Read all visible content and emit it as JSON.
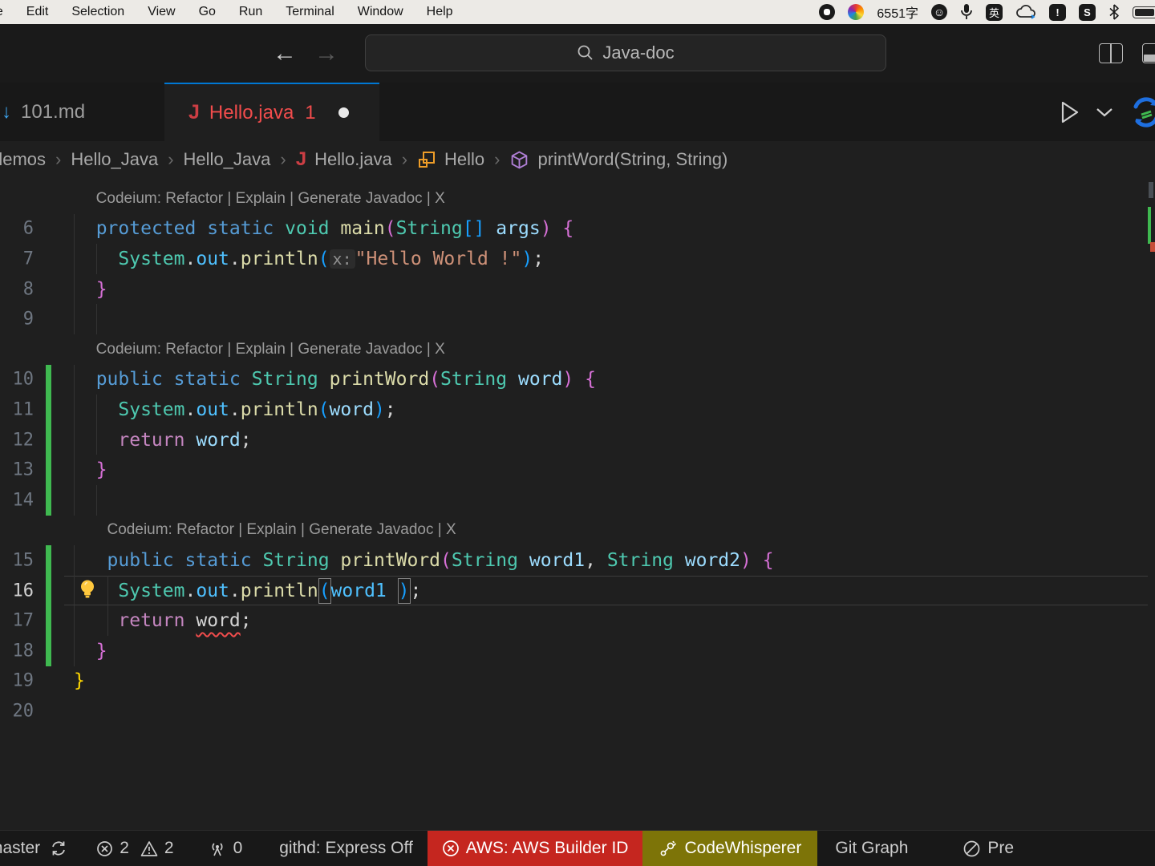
{
  "colors": {
    "accent_blue": "#0078D4",
    "tab_error_red": "#F14C4C",
    "java_icon_red": "#CC3E44",
    "added_green": "#3FB950",
    "error_red": "#F14C4C",
    "aws_red": "#C5261F",
    "codewhisperer_olive": "#7D7408",
    "bulb_yellow": "#FFC83D",
    "class_icon_orange": "#EE9D28",
    "method_icon_purple": "#B180D7"
  },
  "menu_bar": {
    "items": [
      "File",
      "Edit",
      "Selection",
      "View",
      "Go",
      "Run",
      "Terminal",
      "Window",
      "Help"
    ],
    "char_count": "6551字",
    "ime_badge": "英",
    "alert_badge": "!",
    "s_badge": "S"
  },
  "title_bar": {
    "search_value": "Java-doc"
  },
  "tab_bar": {
    "tabs": [
      {
        "name": "101.md",
        "icon": "markdown-icon",
        "icon_glyph": "↓"
      },
      {
        "name": "Hello.java",
        "badge": "1",
        "icon": "java-icon",
        "icon_glyph": "J",
        "modified": true
      }
    ]
  },
  "breadcrumb": [
    "demos",
    "Hello_Java",
    "Hello_Java",
    "Hello.java",
    "Hello",
    "printWord(String, String)"
  ],
  "editor": {
    "codelens": "Codeium: Refactor | Explain | Generate Javadoc | X",
    "rows": [
      {
        "kind": "lens",
        "indent": 2
      },
      {
        "kind": "code",
        "num": "6",
        "guides": [
          0
        ],
        "tokens": [
          [
            "  ",
            "pl"
          ],
          [
            "protected",
            "kw"
          ],
          [
            " ",
            "pl"
          ],
          [
            "static",
            "kw"
          ],
          [
            " ",
            "pl"
          ],
          [
            "void",
            "ty"
          ],
          [
            " ",
            "pl"
          ],
          [
            "main",
            "fn"
          ],
          [
            "(",
            "b2"
          ],
          [
            "String",
            "ty"
          ],
          [
            "[]",
            "b3"
          ],
          [
            " ",
            "pl"
          ],
          [
            "args",
            "vr"
          ],
          [
            ")",
            "b2"
          ],
          [
            " ",
            "pl"
          ],
          [
            "{",
            "b2"
          ]
        ]
      },
      {
        "kind": "code",
        "num": "7",
        "guides": [
          0,
          2
        ],
        "tokens": [
          [
            "    ",
            "pl"
          ],
          [
            "System",
            "ty"
          ],
          [
            ".",
            "pl"
          ],
          [
            "out",
            "pr"
          ],
          [
            ".",
            "pl"
          ],
          [
            "println",
            "fn"
          ],
          [
            "(",
            "b3"
          ],
          [
            "x:",
            "il"
          ],
          [
            "\"Hello World !\"",
            "st"
          ],
          [
            ")",
            "b3"
          ],
          [
            ";",
            "pl"
          ]
        ]
      },
      {
        "kind": "code",
        "num": "8",
        "guides": [
          0
        ],
        "tokens": [
          [
            "  ",
            "pl"
          ],
          [
            "}",
            "b2"
          ]
        ]
      },
      {
        "kind": "code",
        "num": "9",
        "guides": [
          0,
          2
        ],
        "tokens": []
      },
      {
        "kind": "lens",
        "indent": 2
      },
      {
        "kind": "code",
        "num": "10",
        "bar": true,
        "guides": [
          0
        ],
        "tokens": [
          [
            "  ",
            "pl"
          ],
          [
            "public",
            "kw"
          ],
          [
            " ",
            "pl"
          ],
          [
            "static",
            "kw"
          ],
          [
            " ",
            "pl"
          ],
          [
            "String",
            "ty"
          ],
          [
            " ",
            "pl"
          ],
          [
            "printWord",
            "fn"
          ],
          [
            "(",
            "b2"
          ],
          [
            "String",
            "ty"
          ],
          [
            " ",
            "pl"
          ],
          [
            "word",
            "vr"
          ],
          [
            ")",
            "b2"
          ],
          [
            " ",
            "pl"
          ],
          [
            "{",
            "b2"
          ]
        ]
      },
      {
        "kind": "code",
        "num": "11",
        "bar": true,
        "guides": [
          0,
          2
        ],
        "tokens": [
          [
            "    ",
            "pl"
          ],
          [
            "System",
            "ty"
          ],
          [
            ".",
            "pl"
          ],
          [
            "out",
            "pr"
          ],
          [
            ".",
            "pl"
          ],
          [
            "println",
            "fn"
          ],
          [
            "(",
            "b3"
          ],
          [
            "word",
            "vr"
          ],
          [
            ")",
            "b3"
          ],
          [
            ";",
            "pl"
          ]
        ]
      },
      {
        "kind": "code",
        "num": "12",
        "bar": true,
        "guides": [
          0,
          2
        ],
        "tokens": [
          [
            "    ",
            "pl"
          ],
          [
            "return",
            "ct"
          ],
          [
            " ",
            "pl"
          ],
          [
            "word",
            "vr"
          ],
          [
            ";",
            "pl"
          ]
        ]
      },
      {
        "kind": "code",
        "num": "13",
        "bar": true,
        "guides": [
          0
        ],
        "tokens": [
          [
            "  ",
            "pl"
          ],
          [
            "}",
            "b2"
          ]
        ]
      },
      {
        "kind": "code",
        "num": "14",
        "bar": true,
        "guides": [
          0,
          2
        ],
        "tokens": []
      },
      {
        "kind": "lens",
        "indent": 3
      },
      {
        "kind": "code",
        "num": "15",
        "bar": true,
        "guides": [
          0
        ],
        "tokens": [
          [
            "   ",
            "pl"
          ],
          [
            "public",
            "kw"
          ],
          [
            " ",
            "pl"
          ],
          [
            "static",
            "kw"
          ],
          [
            " ",
            "pl"
          ],
          [
            "String",
            "ty"
          ],
          [
            " ",
            "pl"
          ],
          [
            "printWord",
            "fn"
          ],
          [
            "(",
            "b2"
          ],
          [
            "String",
            "ty"
          ],
          [
            " ",
            "pl"
          ],
          [
            "word1",
            "vr"
          ],
          [
            ",",
            "pl"
          ],
          [
            " ",
            "pl"
          ],
          [
            "String",
            "ty"
          ],
          [
            " ",
            "pl"
          ],
          [
            "word2",
            "vr"
          ],
          [
            ")",
            "b2"
          ],
          [
            " ",
            "pl"
          ],
          [
            "{",
            "b2"
          ]
        ]
      },
      {
        "kind": "code",
        "num": "16",
        "bar": true,
        "current": true,
        "bulb": true,
        "guides": [
          0,
          3
        ],
        "tokens": [
          [
            "    ",
            "pl"
          ],
          [
            "System",
            "ty"
          ],
          [
            ".",
            "pl"
          ],
          [
            "out",
            "pr"
          ],
          [
            ".",
            "pl"
          ],
          [
            "println",
            "fn"
          ],
          [
            "(",
            "b3 box"
          ],
          [
            "word1",
            "pr"
          ],
          [
            " ",
            "pl"
          ],
          [
            ")",
            "b3 box"
          ],
          [
            ";",
            "pl"
          ]
        ]
      },
      {
        "kind": "code",
        "num": "17",
        "bar": true,
        "guides": [
          0,
          3
        ],
        "tokens": [
          [
            "    ",
            "pl"
          ],
          [
            "return",
            "ct"
          ],
          [
            " ",
            "pl"
          ],
          [
            "word",
            "er"
          ],
          [
            ";",
            "pl"
          ]
        ]
      },
      {
        "kind": "code",
        "num": "18",
        "bar": true,
        "guides": [
          0
        ],
        "tokens": [
          [
            "  ",
            "pl"
          ],
          [
            "}",
            "b2"
          ]
        ]
      },
      {
        "kind": "code",
        "num": "19",
        "guides": [],
        "tokens": [
          [
            "}",
            "b1"
          ]
        ]
      },
      {
        "kind": "code",
        "num": "20",
        "guides": [],
        "tokens": []
      }
    ]
  },
  "status_bar": {
    "branch": "master",
    "errors": "2",
    "warnings": "2",
    "ports": "0",
    "githd": "githd: Express Off",
    "aws": "AWS: AWS Builder ID",
    "codewhisperer": "CodeWhisperer",
    "gitgraph": "Git Graph",
    "prettier": "Pre"
  }
}
